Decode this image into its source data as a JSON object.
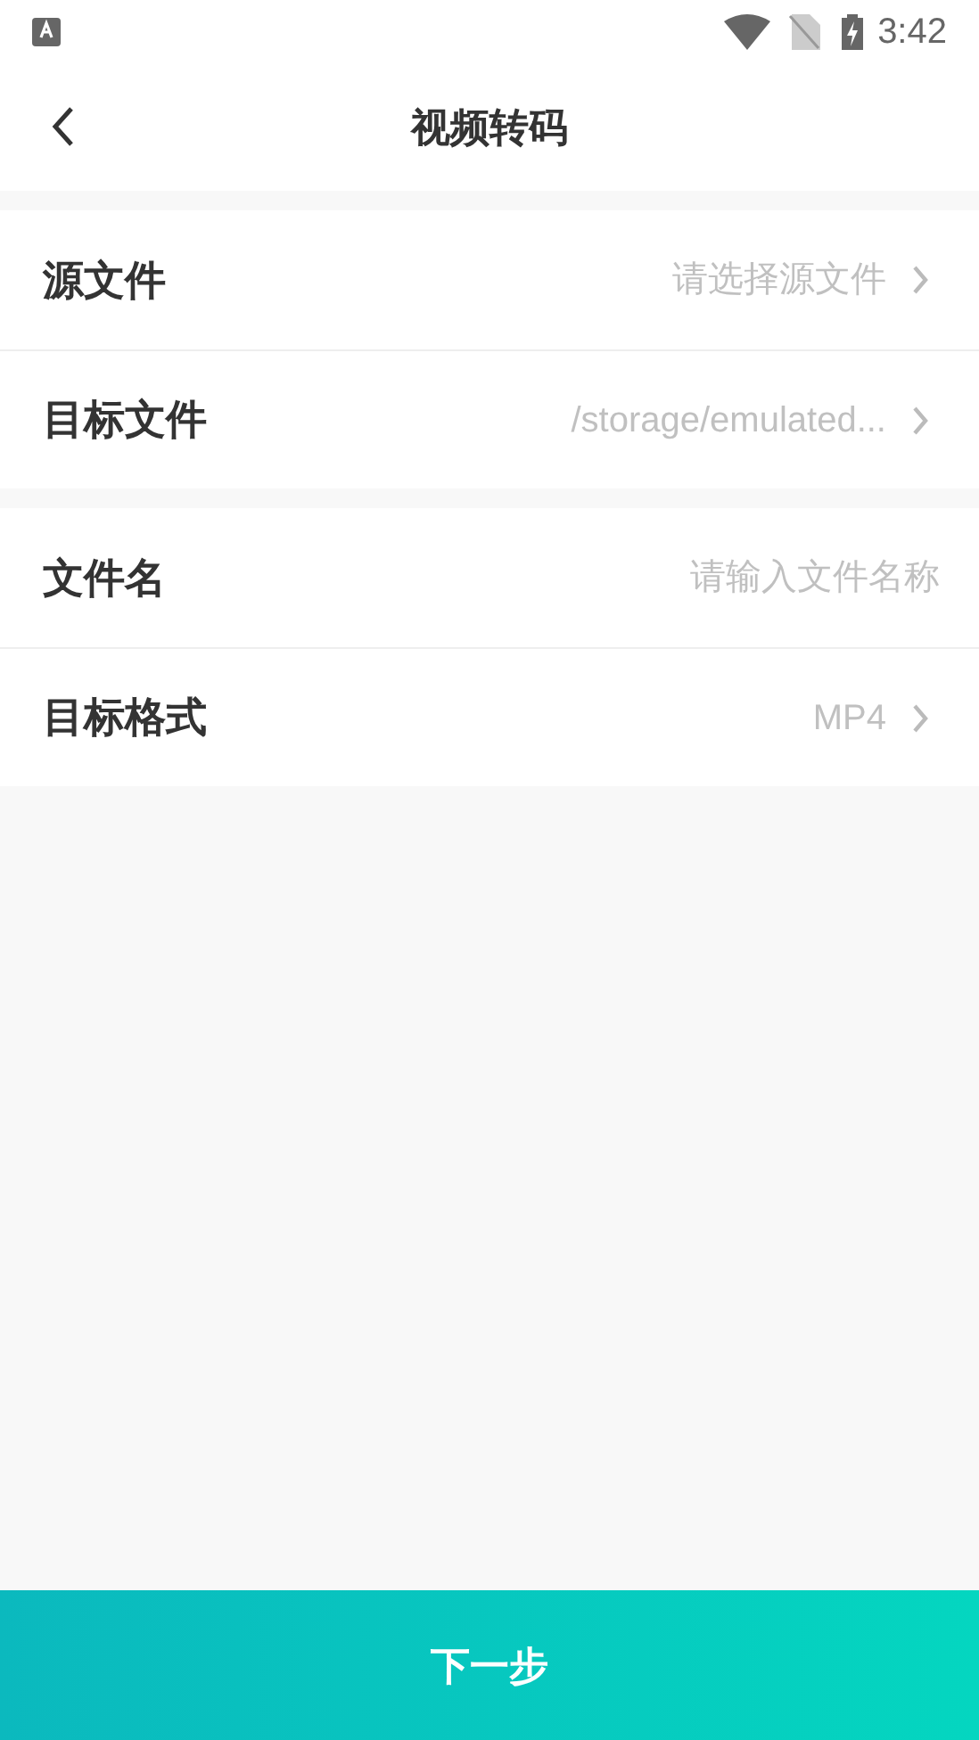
{
  "status_bar": {
    "time": "3:42"
  },
  "header": {
    "title": "视频转码"
  },
  "sections": [
    [
      {
        "kind": "select",
        "label": "源文件",
        "value": "请选择源文件"
      },
      {
        "kind": "select",
        "label": "目标文件",
        "value": "/storage/emulated..."
      }
    ],
    [
      {
        "kind": "input",
        "label": "文件名",
        "placeholder": "请输入文件名称"
      },
      {
        "kind": "select",
        "label": "目标格式",
        "value": "MP4"
      }
    ]
  ],
  "next_button": {
    "label": "下一步"
  }
}
